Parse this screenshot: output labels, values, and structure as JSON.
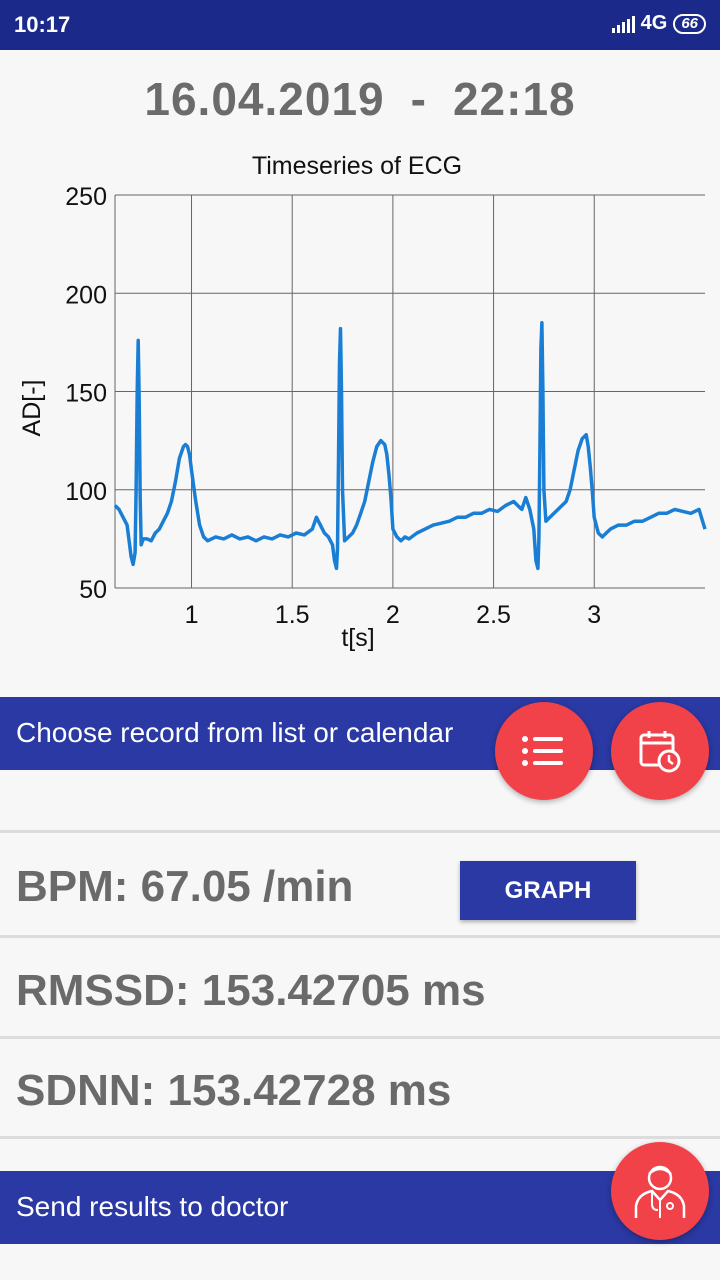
{
  "status_bar": {
    "time": "10:17",
    "network": "4G",
    "battery": "66"
  },
  "record": {
    "date": "16.04.2019",
    "separator": "-",
    "time": "22:18"
  },
  "chart_data": {
    "type": "line",
    "title": "Timeseries of ECG",
    "xlabel": "t[s]",
    "ylabel": "AD[-]",
    "xlim": [
      0.62,
      3.55
    ],
    "ylim": [
      50,
      250
    ],
    "x_ticks": [
      1,
      1.5,
      2,
      2.5,
      3
    ],
    "x_tick_labels": [
      "1",
      "1.5",
      "2",
      "2.5",
      "3"
    ],
    "y_ticks": [
      50,
      100,
      150,
      200,
      250
    ],
    "y_tick_labels": [
      "50",
      "100",
      "150",
      "200",
      "250"
    ],
    "grid": true,
    "series": [
      {
        "color": "#1a7fd4",
        "x": [
          0.62,
          0.64,
          0.66,
          0.68,
          0.69,
          0.7,
          0.71,
          0.72,
          0.725,
          0.73,
          0.735,
          0.74,
          0.745,
          0.75,
          0.76,
          0.78,
          0.8,
          0.82,
          0.84,
          0.86,
          0.88,
          0.9,
          0.92,
          0.94,
          0.96,
          0.97,
          0.98,
          0.99,
          1.0,
          1.02,
          1.04,
          1.06,
          1.08,
          1.12,
          1.16,
          1.2,
          1.24,
          1.28,
          1.32,
          1.36,
          1.4,
          1.44,
          1.48,
          1.52,
          1.56,
          1.6,
          1.62,
          1.64,
          1.66,
          1.68,
          1.7,
          1.71,
          1.72,
          1.725,
          1.73,
          1.735,
          1.74,
          1.745,
          1.75,
          1.76,
          1.78,
          1.8,
          1.82,
          1.84,
          1.86,
          1.88,
          1.9,
          1.92,
          1.94,
          1.96,
          1.97,
          1.98,
          1.99,
          2.0,
          2.02,
          2.04,
          2.06,
          2.08,
          2.12,
          2.16,
          2.2,
          2.24,
          2.28,
          2.32,
          2.36,
          2.4,
          2.44,
          2.48,
          2.52,
          2.56,
          2.6,
          2.62,
          2.64,
          2.66,
          2.68,
          2.7,
          2.71,
          2.72,
          2.725,
          2.73,
          2.735,
          2.74,
          2.745,
          2.75,
          2.76,
          2.78,
          2.8,
          2.82,
          2.84,
          2.86,
          2.88,
          2.9,
          2.92,
          2.94,
          2.96,
          2.97,
          2.98,
          2.99,
          3.0,
          3.02,
          3.04,
          3.06,
          3.08,
          3.12,
          3.16,
          3.2,
          3.24,
          3.28,
          3.32,
          3.36,
          3.4,
          3.44,
          3.48,
          3.52,
          3.55
        ],
        "values": [
          92,
          90,
          86,
          82,
          74,
          66,
          62,
          68,
          100,
          150,
          176,
          145,
          95,
          72,
          75,
          75,
          74,
          78,
          80,
          84,
          88,
          94,
          104,
          116,
          122,
          123,
          122,
          118,
          110,
          95,
          82,
          76,
          74,
          76,
          75,
          77,
          75,
          76,
          74,
          76,
          75,
          77,
          76,
          78,
          77,
          80,
          86,
          82,
          78,
          76,
          72,
          64,
          60,
          70,
          115,
          165,
          182,
          150,
          100,
          74,
          76,
          78,
          82,
          88,
          94,
          104,
          114,
          122,
          125,
          123,
          118,
          108,
          96,
          80,
          76,
          74,
          76,
          75,
          78,
          80,
          82,
          83,
          84,
          86,
          86,
          88,
          88,
          90,
          89,
          92,
          94,
          92,
          90,
          96,
          90,
          80,
          64,
          60,
          75,
          120,
          172,
          185,
          150,
          100,
          84,
          86,
          88,
          90,
          92,
          94,
          100,
          110,
          120,
          126,
          128,
          122,
          112,
          100,
          86,
          78,
          76,
          78,
          80,
          82,
          82,
          84,
          84,
          86,
          88,
          88,
          90,
          89,
          88,
          90,
          80
        ]
      }
    ]
  },
  "record_bar": {
    "label": "Choose record from list or calendar"
  },
  "fabs": {
    "list_icon": "list-icon",
    "calendar_icon": "calendar-clock-icon",
    "doctor_icon": "doctor-icon"
  },
  "metrics": {
    "bpm": "BPM: 67.05 /min",
    "rmssd": "RMSSD: 153.42705 ms",
    "sdnn": "SDNN: 153.42728 ms"
  },
  "graph_button": {
    "label": "GRAPH"
  },
  "send_bar": {
    "label": "Send results to doctor"
  },
  "colors": {
    "primary": "#2a39a3",
    "status_bar": "#1b2a8a",
    "fab": "#f1424a",
    "line": "#1a7fd4",
    "metric_text": "#6a6a6a"
  }
}
